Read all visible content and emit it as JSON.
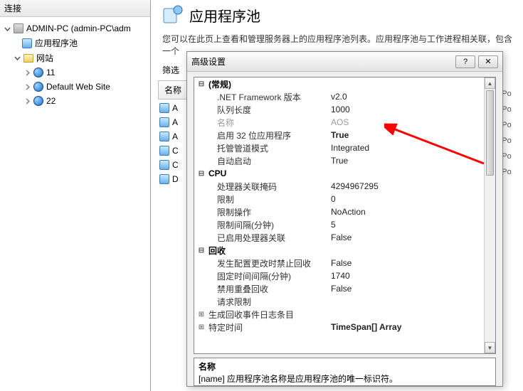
{
  "leftPanel": {
    "header": "连接",
    "server": "ADMIN-PC (admin-PC\\adm",
    "appPools": "应用程序池",
    "sites": "网站",
    "siteList": [
      "11",
      "Default Web Site",
      "22"
    ]
  },
  "page": {
    "title": "应用程序池",
    "description": "您可以在此页上查看和管理服务器上的应用程序池列表。应用程序池与工作进程相关联，包含一个",
    "filterLabel": "筛选",
    "gridHeader": "名称",
    "rows": [
      "A",
      "A",
      "A",
      "C",
      "C",
      "D"
    ]
  },
  "dialog": {
    "title": "高级设置",
    "helpGlyph": "?",
    "closeGlyph": "✕",
    "categories": {
      "general": "(常规)",
      "cpu": "CPU",
      "recycle": "回收"
    },
    "props": {
      "netfx": {
        "label": ".NET Framework 版本",
        "value": "v2.0"
      },
      "queueLen": {
        "label": "队列长度",
        "value": "1000"
      },
      "name": {
        "label": "名称",
        "value": "AOS"
      },
      "enable32": {
        "label": "启用 32 位应用程序",
        "value": "True"
      },
      "pipeline": {
        "label": "托管管道模式",
        "value": "Integrated"
      },
      "autoStart": {
        "label": "自动启动",
        "value": "True"
      },
      "affinityMask": {
        "label": "处理器关联掩码",
        "value": "4294967295"
      },
      "limit": {
        "label": "限制",
        "value": "0"
      },
      "limitAction": {
        "label": "限制操作",
        "value": "NoAction"
      },
      "limitInterval": {
        "label": "限制间隔(分钟)",
        "value": "5"
      },
      "affinityEnabled": {
        "label": "已启用处理器关联",
        "value": "False"
      },
      "disallowOverlap": {
        "label": "发生配置更改时禁止回收",
        "value": "False"
      },
      "periodicTime": {
        "label": "固定时间间隔(分钟)",
        "value": "1740"
      },
      "disallowRotation": {
        "label": "禁用重叠回收",
        "value": "False"
      },
      "requestLimit": {
        "label": "请求限制",
        "value": ""
      },
      "logEvents": {
        "label": "生成回收事件日志条目",
        "value": ""
      },
      "specificTimes": {
        "label": "特定时间",
        "value": "TimeSpan[] Array"
      }
    },
    "desc": {
      "title": "名称",
      "body": "[name] 应用程序池名称是应用程序池的唯一标识符。"
    }
  },
  "sideTruncated": "onPo"
}
